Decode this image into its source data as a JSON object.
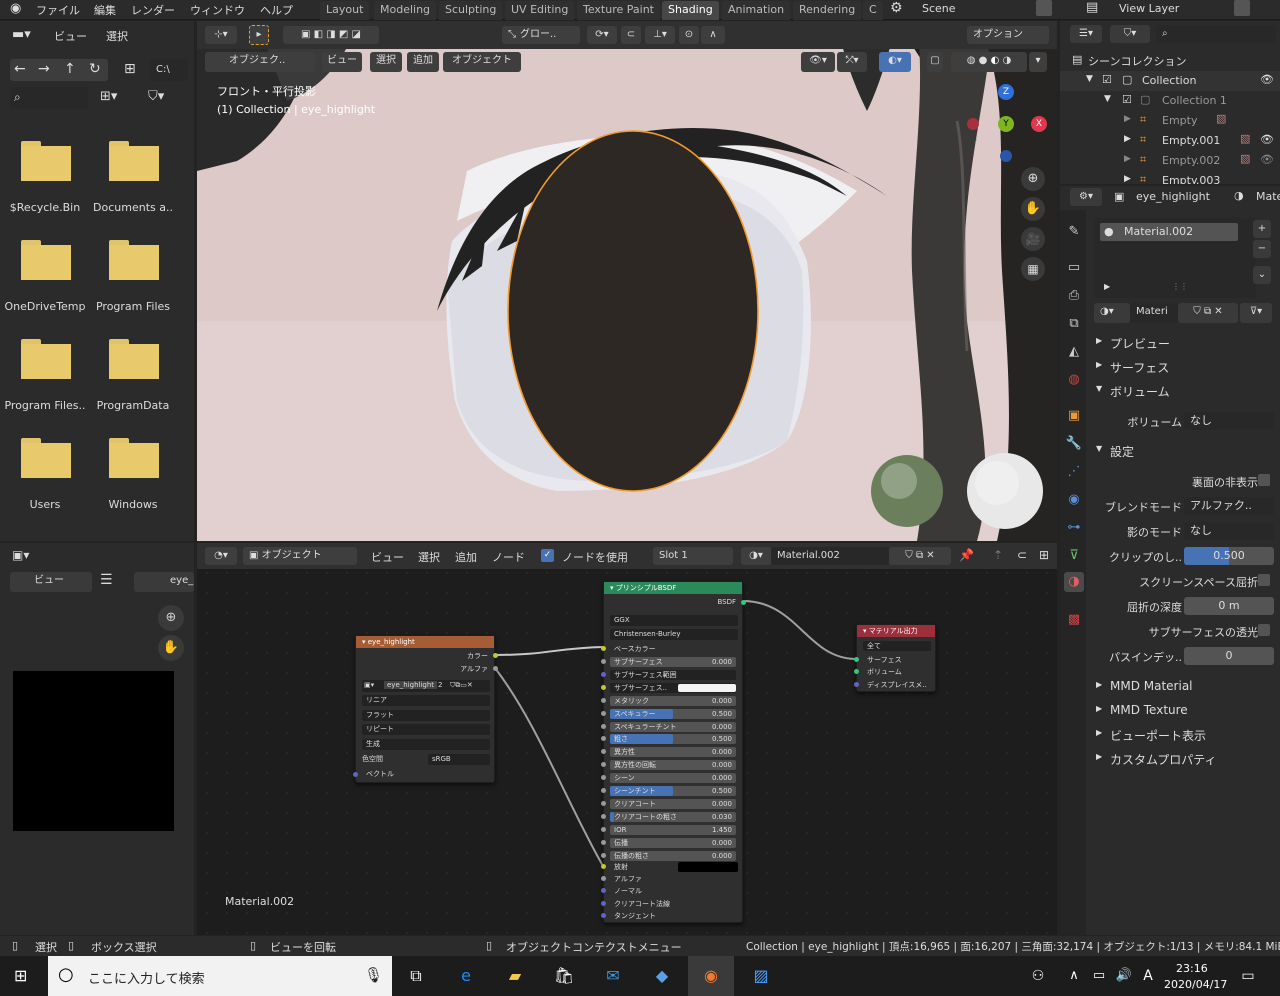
{
  "topmenu": {
    "logo": "blender-icon",
    "items": [
      "ファイル",
      "編集",
      "レンダー",
      "ウィンドウ",
      "ヘルプ"
    ]
  },
  "workspaces": [
    "Layout",
    "Modeling",
    "Sculpting",
    "UV Editing",
    "Texture Paint",
    "Shading",
    "Animation",
    "Rendering",
    "C"
  ],
  "active_workspace": "Shading",
  "scene": {
    "label": "Scene",
    "view_layer": "View Layer"
  },
  "filebrowser": {
    "view": "ビュー",
    "select": "選択",
    "path": "C:\\",
    "folders": [
      "$Recycle.Bin",
      "Documents a..",
      "OneDriveTemp",
      "Program Files",
      "Program Files..",
      "ProgramData",
      "Users",
      "Windows"
    ]
  },
  "imageeditor": {
    "view": "ビュー",
    "image": "eye_"
  },
  "viewport": {
    "mode": "オブジェク..",
    "menus": [
      "ビュー",
      "選択",
      "追加",
      "オブジェクト"
    ],
    "transform": "グロー..",
    "options": "オプション",
    "view_name": "フロント・平行投影",
    "collection_info": "(1) Collection | eye_highlight",
    "gizmo": {
      "z": "Z",
      "y": "Y",
      "x": "X"
    }
  },
  "outliner": {
    "title": "シーンコレクション",
    "items": [
      {
        "label": "Collection",
        "depth": 1
      },
      {
        "label": "Collection 1",
        "depth": 2
      },
      {
        "label": "Empty",
        "depth": 3
      },
      {
        "label": "Empty.001",
        "depth": 3
      },
      {
        "label": "Empty.002",
        "depth": 3
      },
      {
        "label": "Empty.003",
        "depth": 3
      }
    ]
  },
  "properties": {
    "object": "eye_highlight",
    "mat_tab": "Mate",
    "material_slot": "Material.002",
    "material_name": "Materi",
    "sections": {
      "preview": "プレビュー",
      "surface": "サーフェス",
      "volume": "ボリューム",
      "settings": "設定",
      "mmd_material": "MMD Material",
      "mmd_texture": "MMD Texture",
      "viewport_display": "ビューポート表示",
      "custom_props": "カスタムプロパティ"
    },
    "volume_label": "ボリューム",
    "volume_value": "なし",
    "backface": "裏面の非表示",
    "blend_label": "ブレンドモード",
    "blend_value": "アルファク..",
    "shadow_label": "影のモード",
    "shadow_value": "なし",
    "clip_label": "クリップのし..",
    "clip_value": "0.500",
    "clip_fraction": 0.5,
    "ssr": "スクリーンスペース屈折",
    "refr_depth_label": "屈折の深度",
    "refr_depth_value": "0 m",
    "sss_trans": "サブサーフェスの透光",
    "pass_label": "パスインデッ..",
    "pass_value": "0"
  },
  "nodeeditor": {
    "mode": "オブジェクト",
    "menus": [
      "ビュー",
      "選択",
      "追加",
      "ノード"
    ],
    "use_nodes": "ノードを使用",
    "slot": "Slot 1",
    "material": "Material.002",
    "footer_label": "Material.002"
  },
  "nodes": {
    "image": {
      "title": "eye_highlight",
      "out_color": "カラー",
      "out_alpha": "アルファ",
      "img_name": "eye_highlight",
      "users": "2",
      "interp": "リニア",
      "proj": "フラット",
      "ext": "リピート",
      "src": "生成",
      "cs_label": "色空間",
      "cs_value": "sRGB",
      "vec": "ベクトル"
    },
    "bsdf": {
      "title": "プリンシプルBSDF",
      "out": "BSDF",
      "dist": "GGX",
      "sss_method": "Christensen-Burley",
      "base": "ベースカラー",
      "rows": [
        {
          "label": "サブサーフェス",
          "value": "0.000",
          "fill": 0
        },
        {
          "label": "サブサーフェス範囲",
          "value": "",
          "fill": 0
        },
        {
          "label": "サブサーフェス..",
          "value": "",
          "fill": 0
        },
        {
          "label": "メタリック",
          "value": "0.000",
          "fill": 0
        },
        {
          "label": "スペキュラー",
          "value": "0.500",
          "fill": 0.5
        },
        {
          "label": "スペキュラーチント",
          "value": "0.000",
          "fill": 0
        },
        {
          "label": "粗さ",
          "value": "0.500",
          "fill": 0.5
        },
        {
          "label": "異方性",
          "value": "0.000",
          "fill": 0
        },
        {
          "label": "異方性の回転",
          "value": "0.000",
          "fill": 0
        },
        {
          "label": "シーン",
          "value": "0.000",
          "fill": 0
        },
        {
          "label": "シーンチント",
          "value": "0.500",
          "fill": 0.5
        },
        {
          "label": "クリアコート",
          "value": "0.000",
          "fill": 0
        },
        {
          "label": "クリアコートの粗さ",
          "value": "0.030",
          "fill": 0.03
        },
        {
          "label": "IOR",
          "value": "1.450",
          "fill": 0
        },
        {
          "label": "伝播",
          "value": "0.000",
          "fill": 0
        },
        {
          "label": "伝播の粗さ",
          "value": "0.000",
          "fill": 0
        }
      ],
      "emission": "放射",
      "alpha": "アルファ",
      "normal": "ノーマル",
      "clearcoat_normal": "クリアコート法線",
      "tangent": "タンジェント"
    },
    "output": {
      "title": "マテリアル出力",
      "target": "全て",
      "surface": "サーフェス",
      "volume": "ボリューム",
      "disp": "ディスプレイスメ.."
    }
  },
  "statusbar": {
    "select": "選択",
    "box": "ボックス選択",
    "rotate": "ビューを回転",
    "ctx": "オブジェクトコンテクストメニュー",
    "stats": "Collection | eye_highlight | 頂点:16,965 | 面:16,207 | 三角面:32,174 | オブジェクト:1/13 | メモリ:84.1 MiB"
  },
  "taskbar": {
    "search": "ここに入力して検索",
    "time": "23:16",
    "date": "2020/04/17",
    "ime": "A"
  }
}
